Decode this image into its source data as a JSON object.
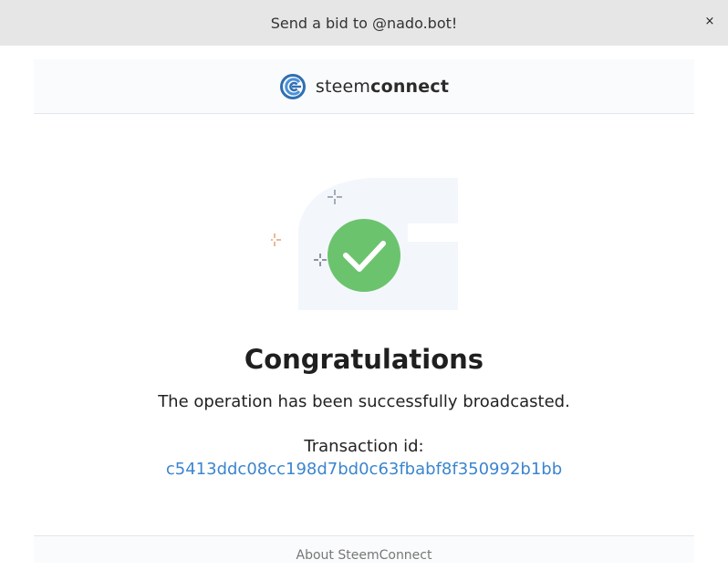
{
  "window": {
    "title": "Send a bid to @nado.bot!",
    "close_label": "×"
  },
  "brand": {
    "name_light": "steem",
    "name_bold": "connect",
    "icon": "steemconnect-logo-icon"
  },
  "illustration": {
    "icon": "check-circle-icon",
    "accent_color": "#6cc36e"
  },
  "result": {
    "heading": "Congratulations",
    "message": "The operation has been successfully broadcasted.",
    "txid_label": "Transaction id:",
    "txid": "c5413ddc08cc198d7bd0c63fbabf8f350992b1bb"
  },
  "footer": {
    "link": "About SteemConnect"
  },
  "colors": {
    "link": "#3b85cf",
    "titlebar": "#e6e6e6",
    "success": "#6cc36e"
  }
}
